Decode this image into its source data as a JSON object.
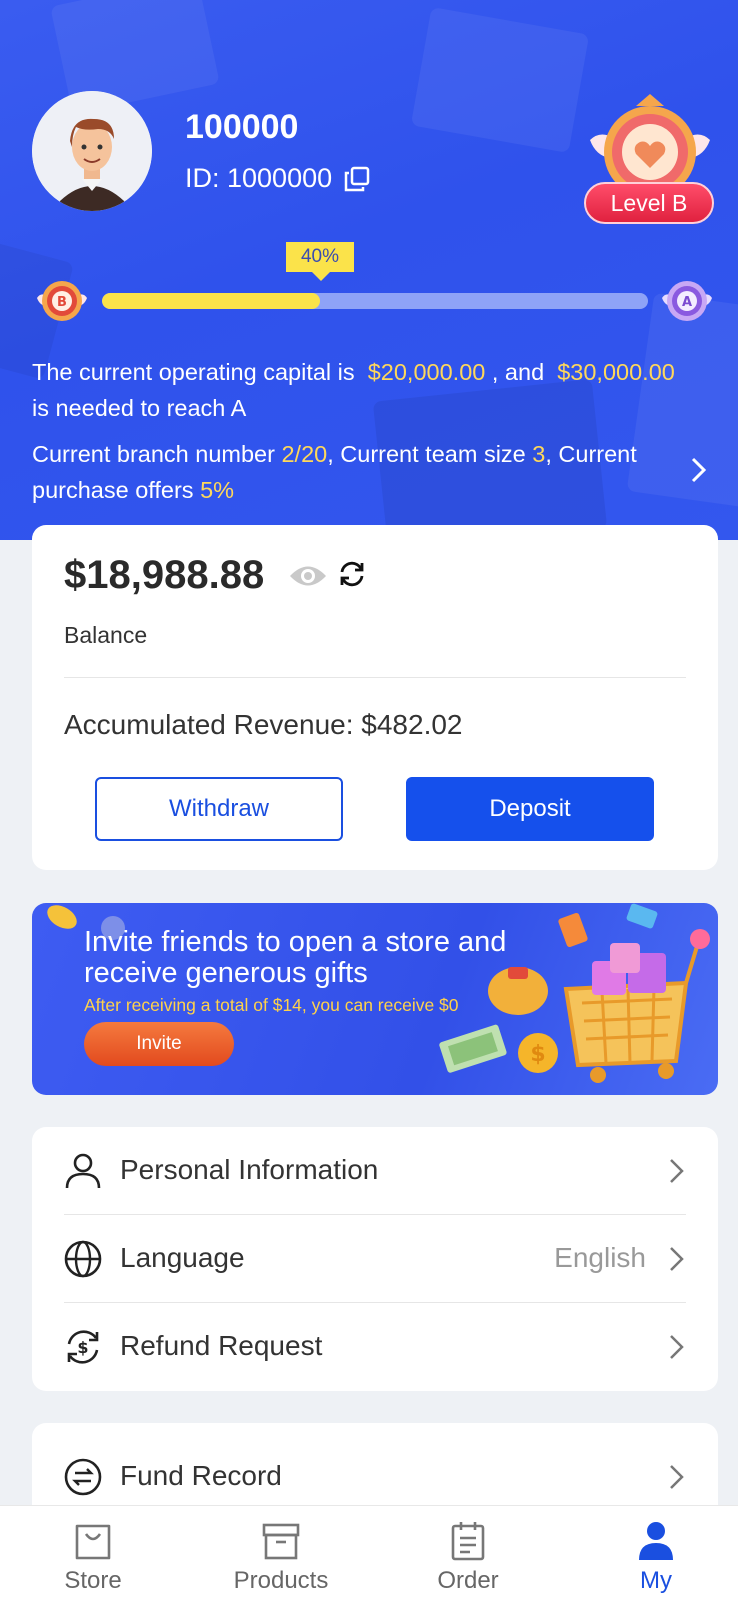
{
  "profile": {
    "name": "100000",
    "id_text": "ID: 1000000",
    "level_label": "Level B"
  },
  "progress": {
    "percent_label": "40%",
    "value": 0.4,
    "current_medal": "B",
    "next_medal": "A"
  },
  "capital": {
    "t1": "The current operating capital is",
    "current": "$20,000.00",
    "t2": ", and",
    "needed": "$30,000.00",
    "t3": "is needed to reach A"
  },
  "branch": {
    "t1": "Current branch number",
    "branch_number": "2/20",
    "t2": ", Current team size",
    "team_size": "3",
    "t3": ", Current purchase offers",
    "offers": "5%"
  },
  "balance": {
    "amount": "$18,988.88",
    "label": "Balance",
    "revenue": "Accumulated Revenue: $482.02",
    "withdraw_label": "Withdraw",
    "deposit_label": "Deposit"
  },
  "invite": {
    "title": "Invite friends to open a store and receive generous gifts",
    "subtitle": "After receiving a total of $14, you can receive $0",
    "button_label": "Invite"
  },
  "menu": {
    "personal_info": "Personal Information",
    "language": "Language",
    "language_value": "English",
    "refund": "Refund Request",
    "fund_record": "Fund Record"
  },
  "tabs": [
    {
      "label": "Store",
      "icon": "bag-icon"
    },
    {
      "label": "Products",
      "icon": "box-icon"
    },
    {
      "label": "Order",
      "icon": "clipboard-icon"
    },
    {
      "label": "My",
      "icon": "user-icon"
    }
  ],
  "colors": {
    "primary": "#1550ec",
    "header_bg": "#3357ee",
    "highlight": "#ffd85a",
    "progress_fill": "#fbe34a",
    "level_badge": "#e0213f"
  }
}
